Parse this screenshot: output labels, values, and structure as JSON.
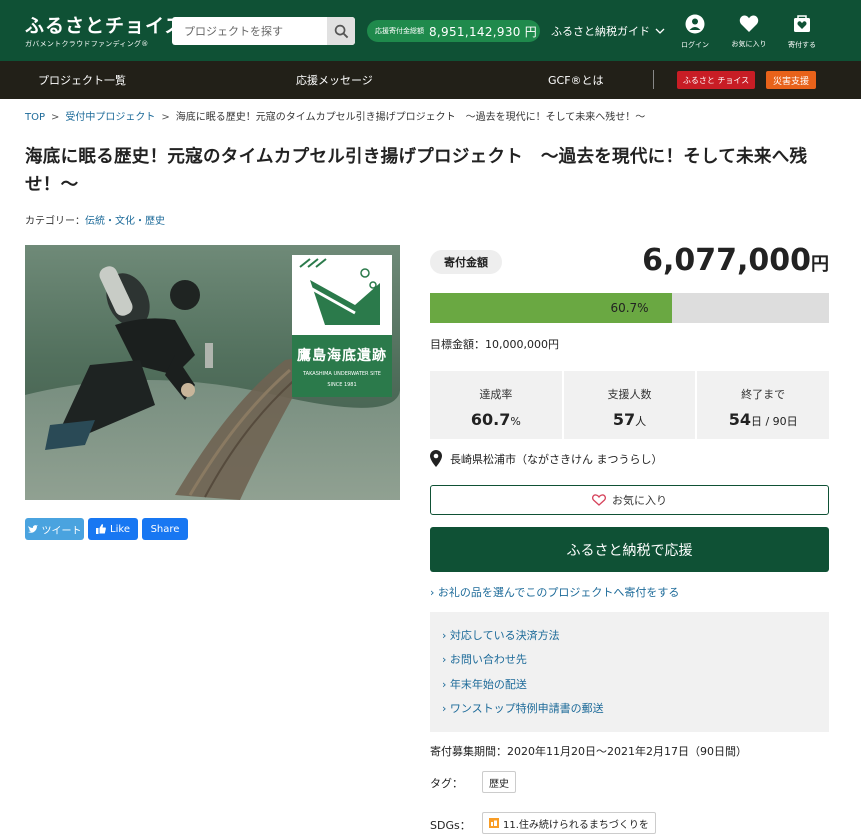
{
  "header": {
    "logo_main": "ふるさとチョイス",
    "logo_sub": "ガバメントクラウドファンディング®",
    "search_placeholder": "プロジェクトを探す",
    "total_label": "応援寄付金総額",
    "total_value": "8,951,142,930 円",
    "guide": "ふるさと納税ガイド",
    "icons": {
      "login": "ログイン",
      "favorites": "お気に入り",
      "donated": "寄付する"
    }
  },
  "nav": {
    "items": [
      "プロジェクト一覧",
      "応援メッセージ",
      "GCF®とは"
    ],
    "badge_red": "ふるさと チョイス",
    "badge_orange": "災害支援"
  },
  "breadcrumb": {
    "top": "TOP",
    "accepting": "受付中プロジェクト",
    "current": "海底に眠る歴史！元寇のタイムカプセル引き揚げプロジェクト　～過去を現代に！そして未来へ残せ！～"
  },
  "project": {
    "title": "海底に眠る歴史！元寇のタイムカプセル引き揚げプロジェクト　～過去を現代に！そして未来へ残せ！～",
    "category_label": "カテゴリー：",
    "category_value": "伝統・文化・歴史",
    "image_logo_text": "鷹島海底遺跡",
    "image_logo_sub": "TAKASHIMA UNDERWATER SITE",
    "image_logo_since": "SINCE 1981"
  },
  "social": {
    "tweet": "ツイート",
    "like": "Like",
    "share": "Share"
  },
  "donation": {
    "label": "寄付金額",
    "amount": "6,077,000",
    "yen": "円",
    "progress_text": "60.7%",
    "progress_fraction": 0.607,
    "target": "目標金額：10,000,000円"
  },
  "stats": [
    {
      "label": "達成率",
      "value": "60.7",
      "unit": "%"
    },
    {
      "label": "支援人数",
      "value": "57",
      "unit": "人"
    },
    {
      "label": "終了まで",
      "value": "54",
      "unit": "日 / 90日"
    }
  ],
  "location": "長崎県松浦市（ながさきけん まつうらし）",
  "buttons": {
    "favorite": "お気に入り",
    "donate": "ふるさと納税で応援"
  },
  "links": {
    "reward": "お礼の品を選んでこのプロジェクトへ寄付をする",
    "box": [
      "対応している決済方法",
      "お問い合わせ先",
      "年末年始の配送",
      "ワンストップ特例申請書の郵送"
    ]
  },
  "period": "寄付募集期間：2020年11月20日～2021年2月17日（90日間）",
  "tags": {
    "label": "タグ：",
    "value": "歴史"
  },
  "sdgs": {
    "label": "SDGs：",
    "value": "11.住み続けられるまちづくりを"
  },
  "colors": {
    "brand_green": "#0f5135",
    "progress_green": "#6aa842",
    "nav_dark": "#222018",
    "link_blue": "#1c6a99",
    "badge_red": "#c81d25",
    "badge_orange": "#e8621a"
  }
}
